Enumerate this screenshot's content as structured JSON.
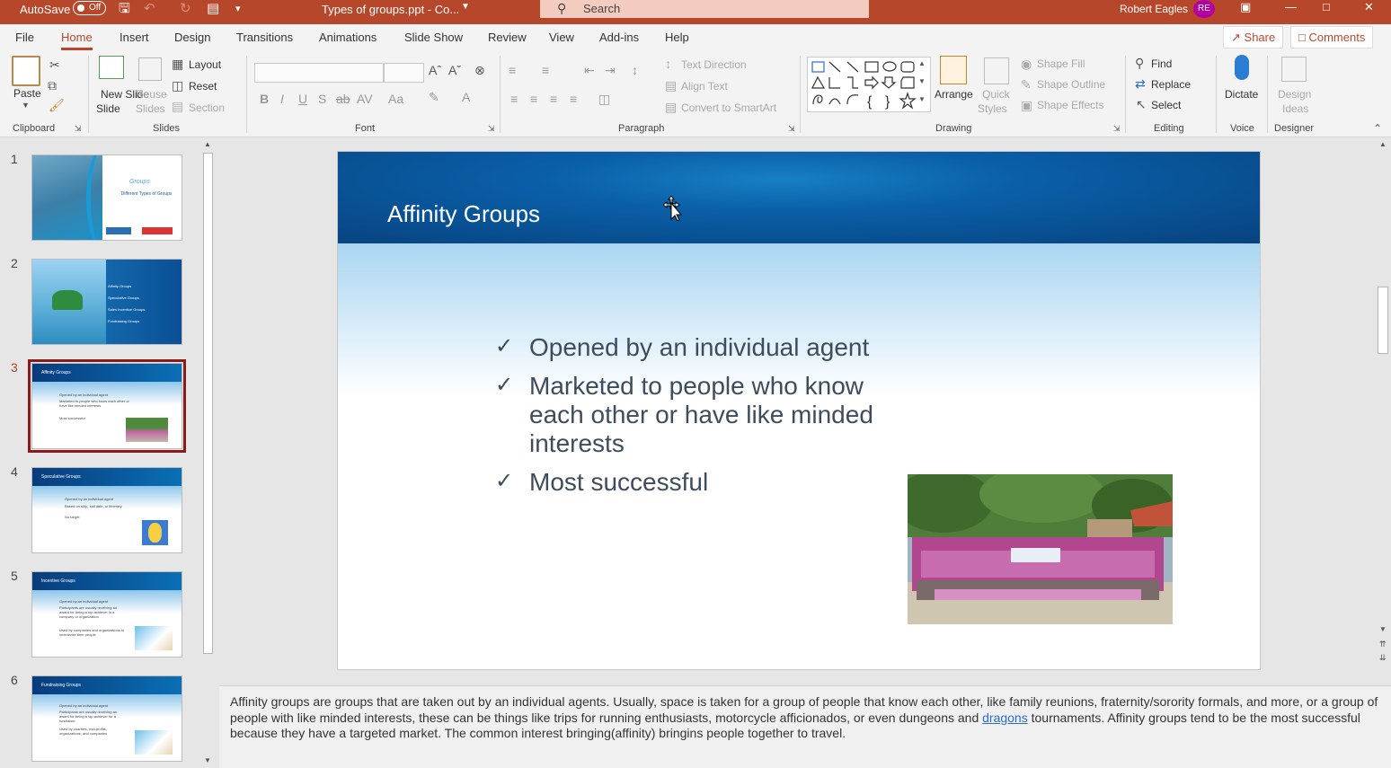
{
  "titlebar": {
    "autosave_label": "AutoSave",
    "autosave_state": "Off",
    "document_title": "Types of groups.ppt  -  Co...",
    "search_placeholder": "Search",
    "user_name": "Robert Eagles",
    "user_initials": "RE"
  },
  "menu": {
    "tabs": [
      "File",
      "Home",
      "Insert",
      "Design",
      "Transitions",
      "Animations",
      "Slide Show",
      "Review",
      "View",
      "Add-ins",
      "Help"
    ],
    "active_tab": "Home",
    "share_label": "Share",
    "comments_label": "Comments"
  },
  "ribbon": {
    "clipboard": {
      "label": "Clipboard",
      "paste": "Paste"
    },
    "slides": {
      "label": "Slides",
      "new_slide": "New Slide",
      "new_slide_2": "Slide",
      "reuse_slides": "Reuse",
      "reuse_slides_2": "Slides",
      "layout": "Layout",
      "reset": "Reset",
      "section": "Section"
    },
    "font": {
      "label": "Font"
    },
    "paragraph": {
      "label": "Paragraph",
      "text_direction": "Text Direction",
      "align_text": "Align Text",
      "convert_smartart": "Convert to SmartArt"
    },
    "drawing": {
      "label": "Drawing",
      "arrange": "Arrange",
      "quick_styles": "Quick",
      "quick_styles_2": "Styles",
      "shape_fill": "Shape Fill",
      "shape_outline": "Shape Outline",
      "shape_effects": "Shape Effects"
    },
    "editing": {
      "label": "Editing",
      "find": "Find",
      "replace": "Replace",
      "select": "Select"
    },
    "voice": {
      "label": "Voice",
      "dictate": "Dictate"
    },
    "designer": {
      "label": "Designer",
      "design_ideas": "Design",
      "design_ideas_2": "Ideas"
    }
  },
  "thumbnails": [
    {
      "num": "1",
      "title": "Groups",
      "subtitle": "Different Types of Groups"
    },
    {
      "num": "2",
      "items": [
        "Affinity Groups",
        "Speculative Groups",
        "Sales Incentive Groups",
        "Fundraising Groups"
      ]
    },
    {
      "num": "3",
      "title": "Affinity Groups",
      "items": [
        "Opened by an individual agent",
        "Marketed to people who know each other or have like minded interests",
        "Most successful"
      ]
    },
    {
      "num": "4",
      "title": "Speculative Groups",
      "items": [
        "Opened by an individual agent",
        "Based on ship, sail date, or itinerary",
        "No target"
      ]
    },
    {
      "num": "5",
      "title": "Incentive Groups",
      "items": [
        "Opened by an individual agent",
        "Participants are usually receiving an award for being a top achiever in a company or organization",
        "Used by companies and organizations to incentivize their people"
      ]
    },
    {
      "num": "6",
      "title": "Fundraising Groups",
      "items": [
        "Opened by an individual agent",
        "Participants are usually receiving an award for being a top achiever for a fundraiser",
        "Used by charities, non-profits, organizations, and companies"
      ]
    }
  ],
  "slide": {
    "title": "Affinity Groups",
    "bullets": [
      "Opened by an individual agent",
      "Marketed to people who know each other or have like minded interests",
      "Most successful"
    ]
  },
  "notes": {
    "text_before": "Affinity groups are groups that are taken out by an individual agents. Usually, space is taken for a group of people that know each other, like family reunions, fraternity/sorority formals, and more, or a group of people with like minded interests, these can be things like trips for running enthusiasts, motorcycle afficionados, or even dungeons and ",
    "underlined_word": "dragons",
    "text_after": " tournaments. Affinity groups tend to be the most successful because they have a targeted market. The common interest bringing(affinity) bringins people together to travel."
  },
  "colors": {
    "accent": "#b7472a",
    "slide_band": "#07427f",
    "selected_thumb": "#8b1a1a"
  }
}
